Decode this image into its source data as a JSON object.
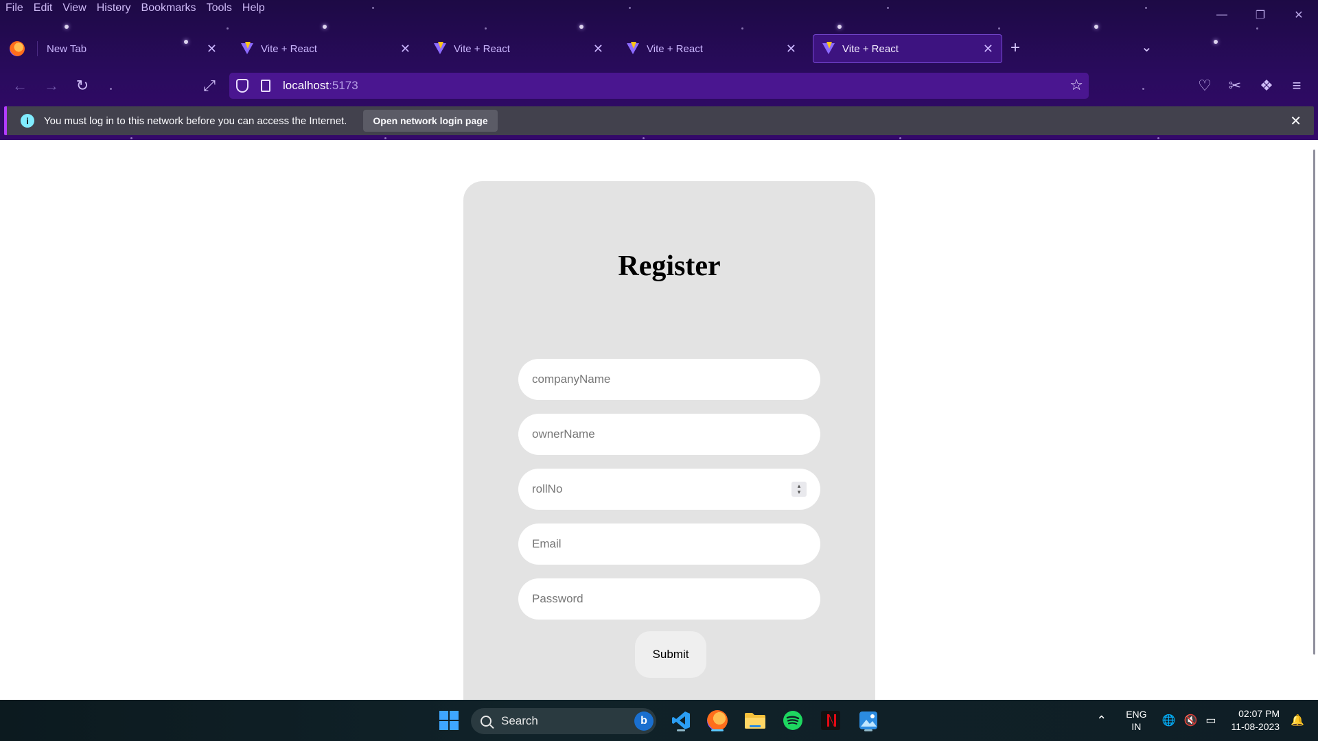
{
  "menubar": {
    "items": [
      "File",
      "Edit",
      "View",
      "History",
      "Bookmarks",
      "Tools",
      "Help"
    ]
  },
  "tabs": [
    {
      "title": "New Tab",
      "active": false
    },
    {
      "title": "Vite + React",
      "active": false
    },
    {
      "title": "Vite + React",
      "active": false
    },
    {
      "title": "Vite + React",
      "active": false
    },
    {
      "title": "Vite + React",
      "active": true
    }
  ],
  "urlbar": {
    "host": "localhost",
    "port": ":5173"
  },
  "notification": {
    "message": "You must log in to this network before you can access the Internet.",
    "button_label": "Open network login page"
  },
  "form": {
    "title": "Register",
    "fields": [
      {
        "placeholder": "companyName",
        "type": "text"
      },
      {
        "placeholder": "ownerName",
        "type": "text"
      },
      {
        "placeholder": "rollNo",
        "type": "number"
      },
      {
        "placeholder": "Email",
        "type": "email"
      },
      {
        "placeholder": "Password",
        "type": "password"
      }
    ],
    "submit_label": "Submit"
  },
  "taskbar": {
    "search_label": "Search",
    "lang_line1": "ENG",
    "lang_line2": "IN",
    "time": "02:07 PM",
    "date": "11-08-2023"
  },
  "colors": {
    "chrome_bg": "#2a0b5e",
    "active_tab_bg": "#3d1380",
    "urlbar_bg": "#4a1690",
    "notification_bg": "#42414d",
    "card_bg": "#e3e3e3"
  }
}
